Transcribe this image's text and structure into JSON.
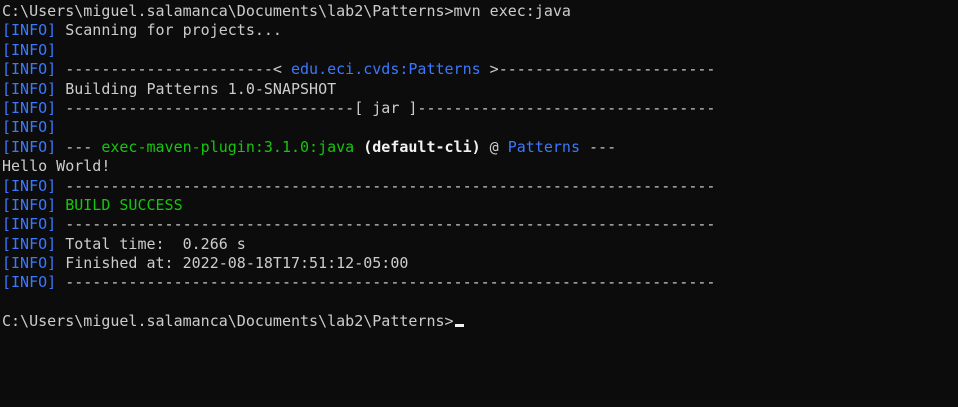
{
  "terminal": {
    "lines": [
      {
        "segments": [
          {
            "text": "C:\\Users\\miguel.salamanca\\Documents\\lab2\\Patterns>mvn exec:java",
            "cls": "grey"
          }
        ]
      },
      {
        "segments": [
          {
            "text": "[INFO]",
            "cls": "info"
          },
          {
            "text": " Scanning for projects...",
            "cls": "grey"
          }
        ]
      },
      {
        "segments": [
          {
            "text": "[INFO]",
            "cls": "info"
          }
        ]
      },
      {
        "segments": [
          {
            "text": "[INFO]",
            "cls": "info"
          },
          {
            "text": " -----------------------< ",
            "cls": "grey"
          },
          {
            "text": "edu.eci.cvds:Patterns",
            "cls": "blue"
          },
          {
            "text": " >------------------------",
            "cls": "grey"
          }
        ]
      },
      {
        "segments": [
          {
            "text": "[INFO]",
            "cls": "info"
          },
          {
            "text": " Building Patterns 1.0-SNAPSHOT",
            "cls": "grey"
          }
        ]
      },
      {
        "segments": [
          {
            "text": "[INFO]",
            "cls": "info"
          },
          {
            "text": " --------------------------------[ jar ]---------------------------------",
            "cls": "grey"
          }
        ]
      },
      {
        "segments": [
          {
            "text": "[INFO]",
            "cls": "info"
          }
        ]
      },
      {
        "segments": [
          {
            "text": "[INFO]",
            "cls": "info"
          },
          {
            "text": " --- ",
            "cls": "grey"
          },
          {
            "text": "exec-maven-plugin:3.1.0:java",
            "cls": "green"
          },
          {
            "text": " (default-cli)",
            "cls": "white"
          },
          {
            "text": " @ ",
            "cls": "grey"
          },
          {
            "text": "Patterns",
            "cls": "blue"
          },
          {
            "text": " ---",
            "cls": "grey"
          }
        ]
      },
      {
        "segments": [
          {
            "text": "Hello World!",
            "cls": "grey"
          }
        ]
      },
      {
        "segments": [
          {
            "text": "[INFO]",
            "cls": "info"
          },
          {
            "text": " ------------------------------------------------------------------------",
            "cls": "grey"
          }
        ]
      },
      {
        "segments": [
          {
            "text": "[INFO]",
            "cls": "info"
          },
          {
            "text": " ",
            "cls": "grey"
          },
          {
            "text": "BUILD SUCCESS",
            "cls": "green"
          }
        ]
      },
      {
        "segments": [
          {
            "text": "[INFO]",
            "cls": "info"
          },
          {
            "text": " ------------------------------------------------------------------------",
            "cls": "grey"
          }
        ]
      },
      {
        "segments": [
          {
            "text": "[INFO]",
            "cls": "info"
          },
          {
            "text": " Total time:  0.266 s",
            "cls": "grey"
          }
        ]
      },
      {
        "segments": [
          {
            "text": "[INFO]",
            "cls": "info"
          },
          {
            "text": " Finished at: 2022-08-18T17:51:12-05:00",
            "cls": "grey"
          }
        ]
      },
      {
        "segments": [
          {
            "text": "[INFO]",
            "cls": "info"
          },
          {
            "text": " ------------------------------------------------------------------------",
            "cls": "grey"
          }
        ]
      },
      {
        "segments": [
          {
            "text": "",
            "cls": "grey"
          }
        ]
      },
      {
        "segments": [
          {
            "text": "C:\\Users\\miguel.salamanca\\Documents\\lab2\\Patterns>",
            "cls": "grey"
          }
        ],
        "cursor": true
      }
    ]
  },
  "colors": {
    "background": "#0c0c0c",
    "text": "#cccccc",
    "info_tag": "#3b78ff",
    "success": "#16c60c",
    "highlight": "#f2f2f2"
  }
}
